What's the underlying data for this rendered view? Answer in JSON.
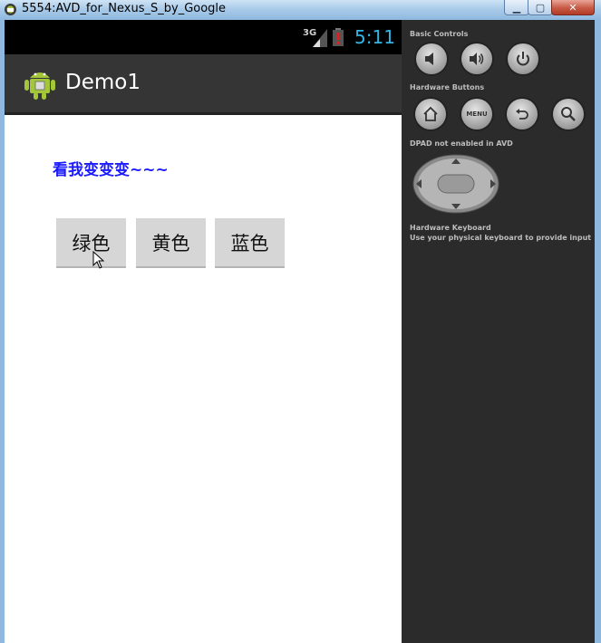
{
  "window": {
    "title": "5554:AVD_for_Nexus_S_by_Google",
    "minimize_label": "▁",
    "maximize_label": "▢",
    "close_label": "✕"
  },
  "device": {
    "status_bar": {
      "network": "3G",
      "time": "5:11"
    },
    "action_bar": {
      "title": "Demo1"
    },
    "content": {
      "headline": "看我变变变~~~",
      "buttons": [
        {
          "label": "绿色"
        },
        {
          "label": "黄色"
        },
        {
          "label": "蓝色"
        }
      ]
    }
  },
  "controls": {
    "basic_controls_label": "Basic Controls",
    "hardware_buttons_label": "Hardware Buttons",
    "dpad_label": "DPAD not enabled in AVD",
    "keyboard_label": "Hardware Keyboard",
    "keyboard_hint": "Use your physical keyboard to provide input",
    "menu_label": "MENU"
  },
  "colors": {
    "headline": "#1a1aff",
    "clock": "#33b5e5",
    "action_bar": "#353535",
    "panel": "#2b2b2b"
  }
}
